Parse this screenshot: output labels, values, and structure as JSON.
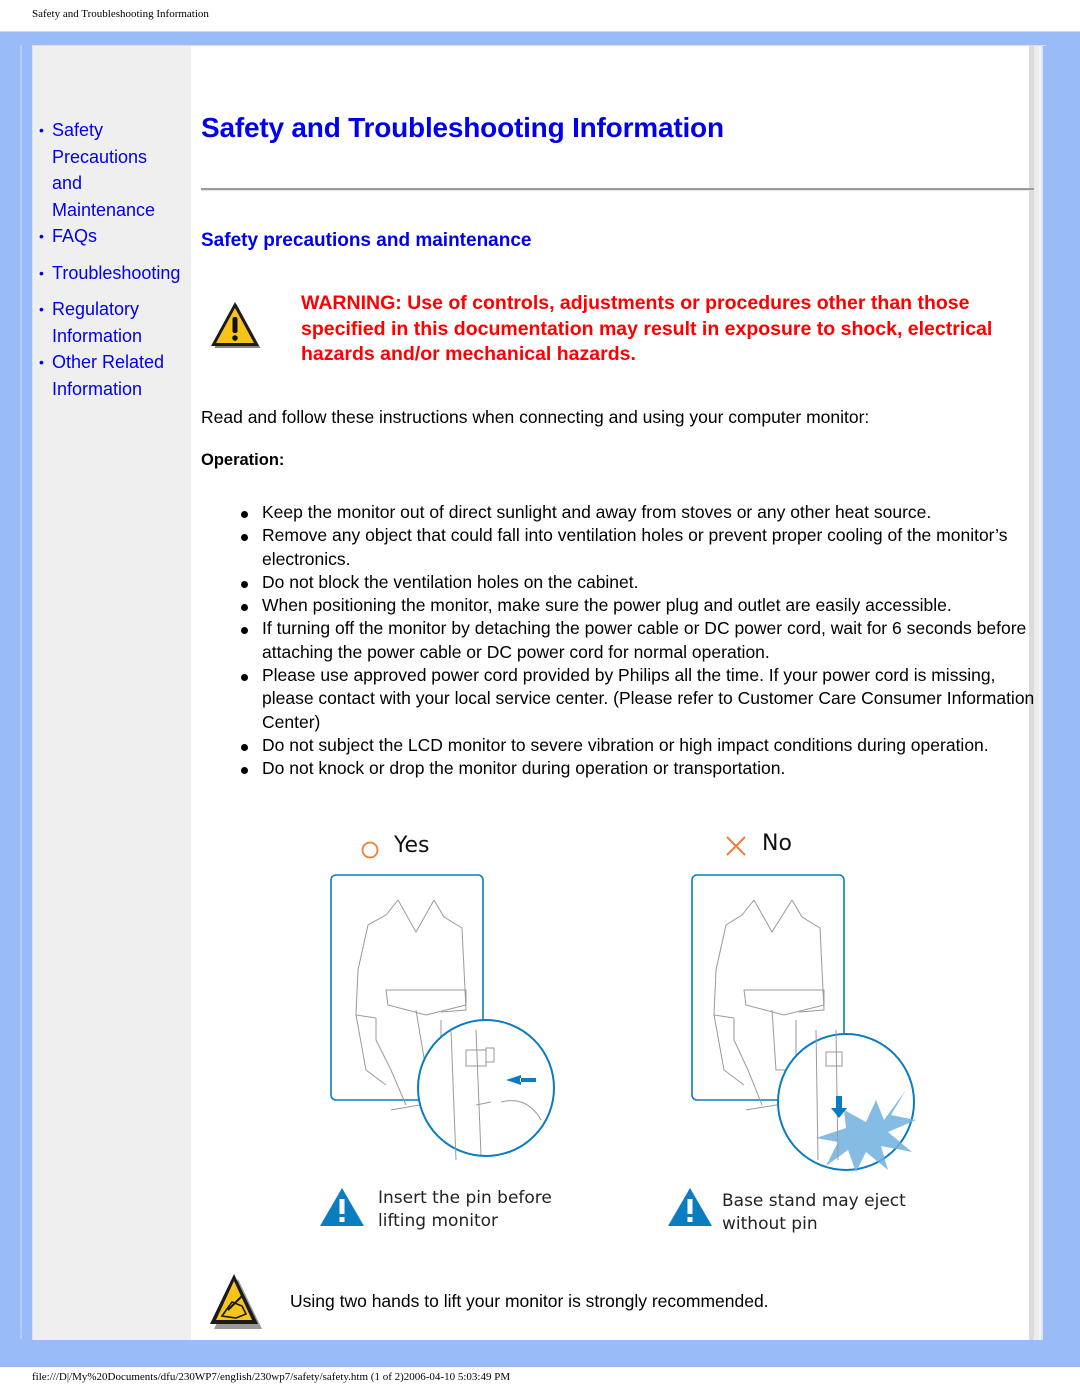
{
  "print_header": "Safety and Troubleshooting Information",
  "print_footer": "file:///D|/My%20Documents/dfu/230WP7/english/230wp7/safety/safety.htm (1 of 2)2006-04-10 5:03:49 PM",
  "sidebar": {
    "bullet": "•",
    "items": [
      {
        "label": "Safety Precautions and Maintenance"
      },
      {
        "label": "FAQs"
      },
      {
        "label": "Troubleshooting"
      },
      {
        "label": "Regulatory Information"
      },
      {
        "label": "Other Related Information"
      }
    ]
  },
  "main": {
    "title": "Safety and Troubleshooting Information",
    "section_title": "Safety precautions and maintenance",
    "warning_icon": "warning-triangle-icon",
    "warning_text": "WARNING: Use of controls, adjustments or procedures other than those specified in this documentation may result in exposure to shock, electrical hazards and/or mechanical hazards.",
    "intro": "Read and follow these instructions when connecting and using your computer monitor:",
    "operation_heading": "Operation:",
    "operation_items": [
      "Keep the monitor out of direct sunlight and away from stoves or any other heat source.",
      "Remove any object that could fall into ventilation holes or prevent proper cooling of the monitor’s electronics.",
      "Do not block the ventilation holes on the cabinet.",
      "When positioning the monitor, make sure the power plug and outlet are easily accessible.",
      "If turning off the monitor by detaching the power cable or DC power cord, wait for 6 seconds before attaching the power cable or DC power cord for normal operation.",
      "Please use approved power cord provided by Philips all the time. If your power cord is missing, please contact with your local service center. (Please refer to Customer Care Consumer Information Center)",
      "Do not subject the LCD monitor to severe vibration or high impact conditions during operation.",
      "Do not knock or drop the monitor during operation or transportation."
    ],
    "figure": {
      "yes_label": "Yes",
      "no_label": "No",
      "yes_caption_line1": "Insert the pin before",
      "yes_caption_line2": "lifting monitor",
      "no_caption_line1": "Base stand may eject",
      "no_caption_line2": "without pin",
      "accent_color": "#0a7cc0",
      "mark_color": "#f27d3b"
    },
    "note_icon": "note-hand-triangle-icon",
    "note_text": "Using two hands to lift your monitor is strongly recommended."
  },
  "colors": {
    "frame": "#99bbf7",
    "link": "#0000ee",
    "warning": "#ff0000",
    "sidebar_bg": "#efefef"
  }
}
